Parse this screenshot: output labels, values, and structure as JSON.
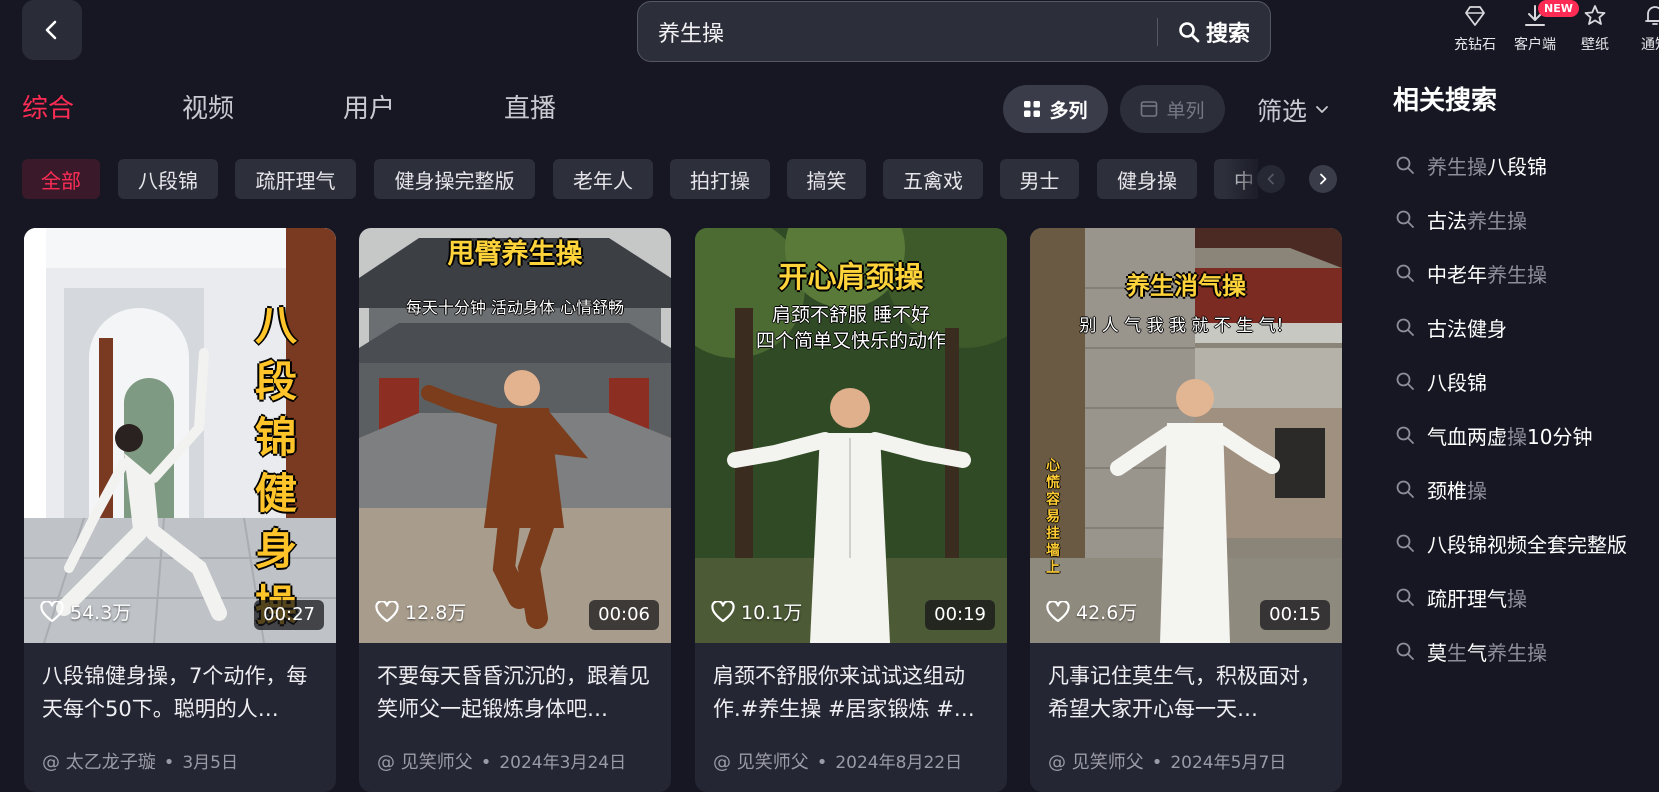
{
  "search": {
    "query": "养生操",
    "button_label": "搜索"
  },
  "top_actions": [
    {
      "label": "充钻石",
      "icon": "diamond-icon"
    },
    {
      "label": "客户端",
      "icon": "download-icon"
    },
    {
      "label": "壁纸",
      "icon": "wallpaper-icon"
    },
    {
      "label": "通知",
      "icon": "bell-icon"
    }
  ],
  "new_badge": "NEW",
  "tabs": [
    "综合",
    "视频",
    "用户",
    "直播"
  ],
  "active_tab": "综合",
  "view_modes": {
    "multi": "多列",
    "single": "单列"
  },
  "filter_label": "筛选",
  "chips": [
    "全部",
    "八段锦",
    "疏肝理气",
    "健身操完整版",
    "老年人",
    "拍打操",
    "搞笑",
    "五禽戏",
    "男士",
    "健身操",
    "中"
  ],
  "active_chip": "全部",
  "videos": [
    {
      "overlay_title": "八段锦健身操",
      "likes": "54.3万",
      "duration": "00:27",
      "description": "八段锦健身操，7个动作，每天每个50下。聪明的人…",
      "author": "@ 太乙龙子璇",
      "date": "3月5日"
    },
    {
      "overlay_title": "甩臂养生操",
      "overlay_subtitle": "每天十分钟 活动身体 心情舒畅",
      "likes": "12.8万",
      "duration": "00:06",
      "description": "不要每天昏昏沉沉的，跟着见笑师父一起锻炼身体吧…",
      "author": "@ 见笑师父",
      "date": "2024年3月24日"
    },
    {
      "overlay_title": "开心肩颈操",
      "overlay_subtitle_1": "肩颈不舒服 睡不好",
      "overlay_subtitle_2": "四个简单又快乐的动作",
      "likes": "10.1万",
      "duration": "00:19",
      "description": "肩颈不舒服你来试试这组动作.#养生操 #居家锻炼 #…",
      "author": "@ 见笑师父",
      "date": "2024年8月22日"
    },
    {
      "overlay_title": "养生消气操",
      "overlay_subtitle": "别 人 气 我  我 就 不 生 气！",
      "overlay_side": "心慌容易挂墙上",
      "likes": "42.6万",
      "duration": "00:15",
      "description": "凡事记住莫生气，积极面对，希望大家开心每一天…",
      "author": "@ 见笑师父",
      "date": "2024年5月7日"
    }
  ],
  "related": {
    "title": "相关搜索",
    "items": [
      {
        "parts": [
          {
            "t": "养生操",
            "hl": true
          },
          {
            "t": "八段锦",
            "hl": false
          }
        ]
      },
      {
        "parts": [
          {
            "t": "古法",
            "hl": false
          },
          {
            "t": "养生操",
            "hl": true
          }
        ]
      },
      {
        "parts": [
          {
            "t": "中老年",
            "hl": false
          },
          {
            "t": "养生操",
            "hl": true
          }
        ]
      },
      {
        "parts": [
          {
            "t": "古法健身",
            "hl": false
          }
        ]
      },
      {
        "parts": [
          {
            "t": "八段锦",
            "hl": false
          }
        ]
      },
      {
        "parts": [
          {
            "t": "气血两虚",
            "hl": false
          },
          {
            "t": "操",
            "hl": true
          },
          {
            "t": "10分钟",
            "hl": false
          }
        ]
      },
      {
        "parts": [
          {
            "t": "颈椎",
            "hl": false
          },
          {
            "t": "操",
            "hl": true
          }
        ]
      },
      {
        "parts": [
          {
            "t": "八段锦视频全套完整版",
            "hl": false
          }
        ]
      },
      {
        "parts": [
          {
            "t": "疏肝理气",
            "hl": false
          },
          {
            "t": "操",
            "hl": true
          }
        ]
      },
      {
        "parts": [
          {
            "t": "莫",
            "hl": false
          },
          {
            "t": "生",
            "hl": true
          },
          {
            "t": "气",
            "hl": false
          },
          {
            "t": "养生操",
            "hl": true
          }
        ]
      }
    ]
  },
  "colors": {
    "accent": "#fe2c55",
    "background": "#161722",
    "card": "#242633",
    "overlay_yellow": "#ffd33a"
  }
}
